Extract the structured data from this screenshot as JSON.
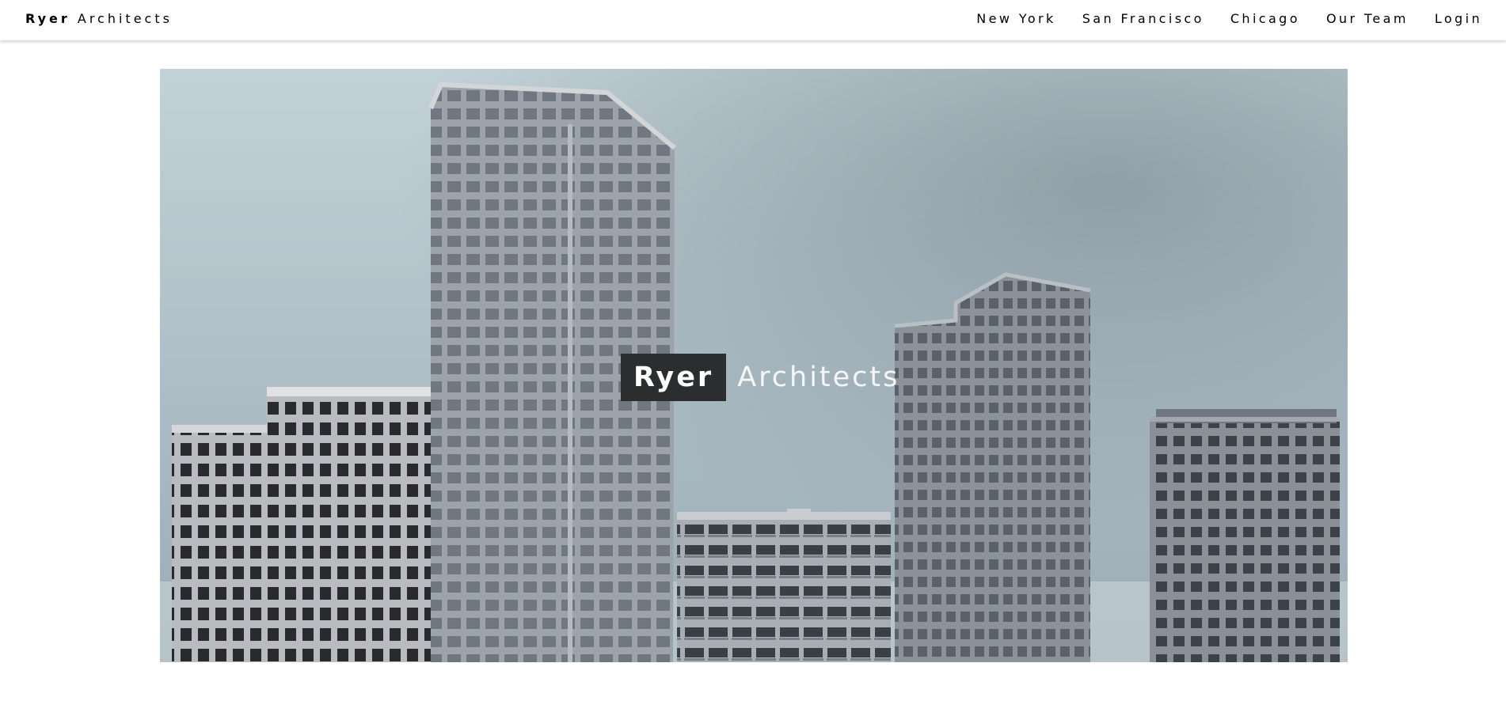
{
  "header": {
    "brand_bold": "Ryer",
    "brand_rest": "Architects",
    "nav": [
      {
        "label": "New York"
      },
      {
        "label": "San Francisco"
      },
      {
        "label": "Chicago"
      },
      {
        "label": "Our Team"
      },
      {
        "label": "Login"
      }
    ]
  },
  "hero": {
    "title_bold": "Ryer",
    "title_rest": "Architects"
  }
}
